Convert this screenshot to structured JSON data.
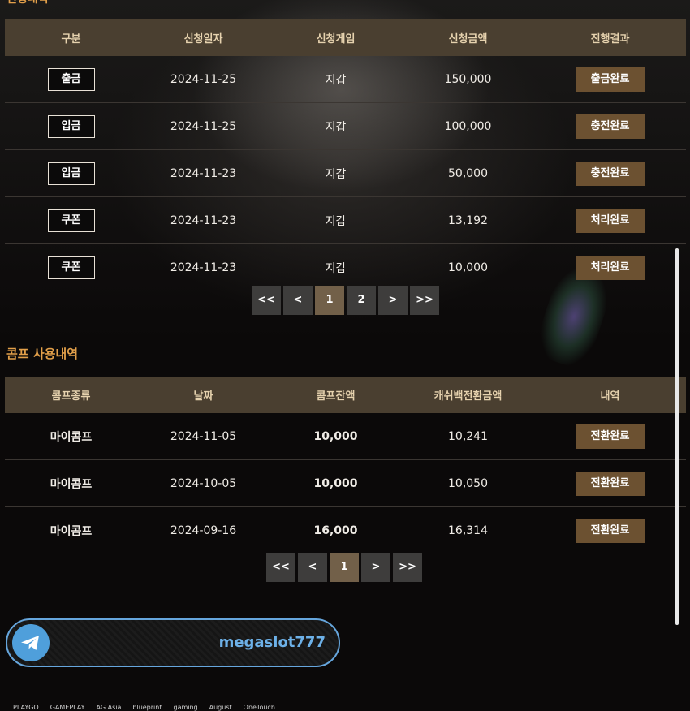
{
  "section1_title_partial": "신청내역",
  "requests": {
    "headers": [
      "구분",
      "신청일자",
      "신청게임",
      "신청금액",
      "진행결과"
    ],
    "rows": [
      {
        "type": "출금",
        "date": "2024-11-25",
        "game": "지갑",
        "amount": "150,000",
        "status": "출금완료"
      },
      {
        "type": "입금",
        "date": "2024-11-25",
        "game": "지갑",
        "amount": "100,000",
        "status": "충전완료"
      },
      {
        "type": "입금",
        "date": "2024-11-23",
        "game": "지갑",
        "amount": "50,000",
        "status": "충전완료"
      },
      {
        "type": "쿠폰",
        "date": "2024-11-23",
        "game": "지갑",
        "amount": "13,192",
        "status": "처리완료"
      },
      {
        "type": "쿠폰",
        "date": "2024-11-23",
        "game": "지갑",
        "amount": "10,000",
        "status": "처리완료"
      }
    ],
    "pagination": {
      "first": "<<",
      "prev": "<",
      "pages": [
        "1",
        "2"
      ],
      "next": ">",
      "last": ">>",
      "current": "1"
    }
  },
  "comp_section_title": "콤프 사용내역",
  "comp": {
    "headers": [
      "콤프종류",
      "날짜",
      "콤프잔액",
      "캐쉬백전환금액",
      "내역"
    ],
    "rows": [
      {
        "kind": "마이콤프",
        "date": "2024-11-05",
        "balance": "10,000",
        "cashback": "10,241",
        "status": "전환완료"
      },
      {
        "kind": "마이콤프",
        "date": "2024-10-05",
        "balance": "10,000",
        "cashback": "10,050",
        "status": "전환완료"
      },
      {
        "kind": "마이콤프",
        "date": "2024-09-16",
        "balance": "16,000",
        "cashback": "16,314",
        "status": "전환완료"
      }
    ],
    "pagination": {
      "first": "<<",
      "prev": "<",
      "pages": [
        "1"
      ],
      "next": ">",
      "last": ">>",
      "current": "1"
    }
  },
  "telegram": {
    "icon": "telegram-icon",
    "handle": "megaslot777"
  },
  "provider_logos": [
    "PLAYGO",
    "GAMEPLAY",
    "AG Asia",
    "blueprint",
    "gaming",
    "August",
    "OneTouch"
  ],
  "colors": {
    "accent": "#e3a04a",
    "header_bg": "#4a3f30",
    "status_bg": "#6c5131",
    "telegram": "#4f9fdb"
  }
}
